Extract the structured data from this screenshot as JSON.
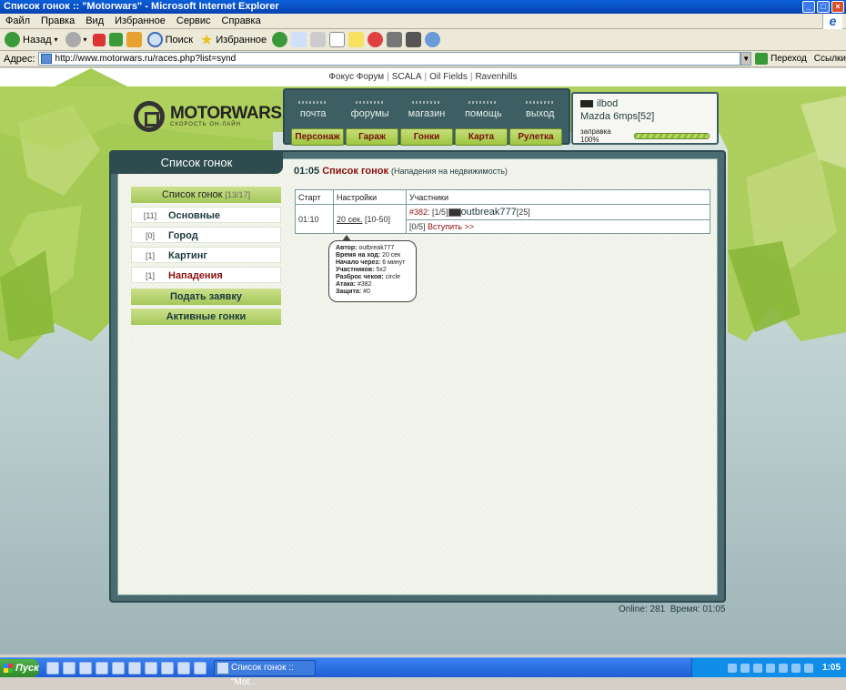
{
  "window": {
    "title": "Список гонок :: \"Motorwars\" - Microsoft Internet Explorer"
  },
  "menu": [
    "Файл",
    "Правка",
    "Вид",
    "Избранное",
    "Сервис",
    "Справка"
  ],
  "toolbar": {
    "back": "Назад",
    "search": "Поиск",
    "favorites": "Избранное"
  },
  "address": {
    "label": "Адрес:",
    "url": "http://www.motorwars.ru/races.php?list=synd",
    "go": "Переход",
    "links": "Ссылки"
  },
  "top_links": [
    "Фокус Форум",
    "SCALA",
    "Oil Fields",
    "Ravenhills"
  ],
  "logo": {
    "name": "MOTORWARS.RU",
    "tagline": "СКОРОСТЬ ОН-ЛАЙН"
  },
  "nav_top": [
    "почта",
    "форумы",
    "магазин",
    "помощь",
    "выход"
  ],
  "nav_bottom": [
    "Персонаж",
    "Гараж",
    "Гонки",
    "Карта",
    "Рулетка"
  ],
  "user": {
    "name": "ilbod",
    "car": "Mazda 6mps[52]",
    "fuel_label": "заправка 100%",
    "fuel_fraction": 1.0
  },
  "sidebar": {
    "header": "Список гонок",
    "list_title": "Список гонок",
    "list_count": "[13/17]",
    "items": [
      {
        "count": "[11]",
        "label": "Основные"
      },
      {
        "count": "[0]",
        "label": "Город"
      },
      {
        "count": "[1]",
        "label": "Картинг"
      },
      {
        "count": "[1]",
        "label": "Нападения"
      }
    ],
    "buttons": [
      "Подать заявку",
      "Активные гонки"
    ]
  },
  "page": {
    "time": "01:05",
    "title": "Список гонок",
    "subtitle": "(Нападения на недвижимость)"
  },
  "table": {
    "headers": [
      "Старт",
      "Настройки",
      "Участники"
    ],
    "row": {
      "start": "01:10",
      "settings_link": "20 сек.",
      "settings_range": "[10-50]",
      "race_id": "#382:",
      "slots": "[1/5]",
      "player": "outbreak777",
      "player_level": "[25]",
      "join_slots": "[0/5]",
      "join_label": "Вступить >>"
    }
  },
  "tooltip": [
    {
      "k": "Автор:",
      "v": "outbreak777"
    },
    {
      "k": "Время на ход:",
      "v": "20 сек"
    },
    {
      "k": "Начало через:",
      "v": "6 минут"
    },
    {
      "k": "Участников:",
      "v": "5x2"
    },
    {
      "k": "Разброс чеков:",
      "v": "circle"
    },
    {
      "k": "Атака:",
      "v": "#382"
    },
    {
      "k": "Защита:",
      "v": "#0"
    }
  ],
  "status": {
    "online": "Online: 281",
    "time": "Время: 01:05"
  },
  "taskbar": {
    "start": "Пуск",
    "task": "Список гонок :: \"Mot...",
    "clock": "1:05"
  }
}
